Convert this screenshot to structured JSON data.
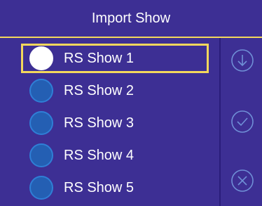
{
  "header": {
    "title": "Import Show"
  },
  "shows": [
    {
      "label": "RS Show 1",
      "selected": true
    },
    {
      "label": "RS Show 2",
      "selected": false
    },
    {
      "label": "RS Show 3",
      "selected": false
    },
    {
      "label": "RS Show 4",
      "selected": false
    },
    {
      "label": "RS Show 5",
      "selected": false
    }
  ],
  "side_actions": [
    {
      "icon": "download-circle-icon"
    },
    {
      "icon": "check-circle-icon"
    },
    {
      "icon": "close-circle-icon"
    }
  ],
  "colors": {
    "background": "#3d2f94",
    "accent": "#f3d75c",
    "radio": "#245fb3",
    "text": "#ffffff"
  }
}
